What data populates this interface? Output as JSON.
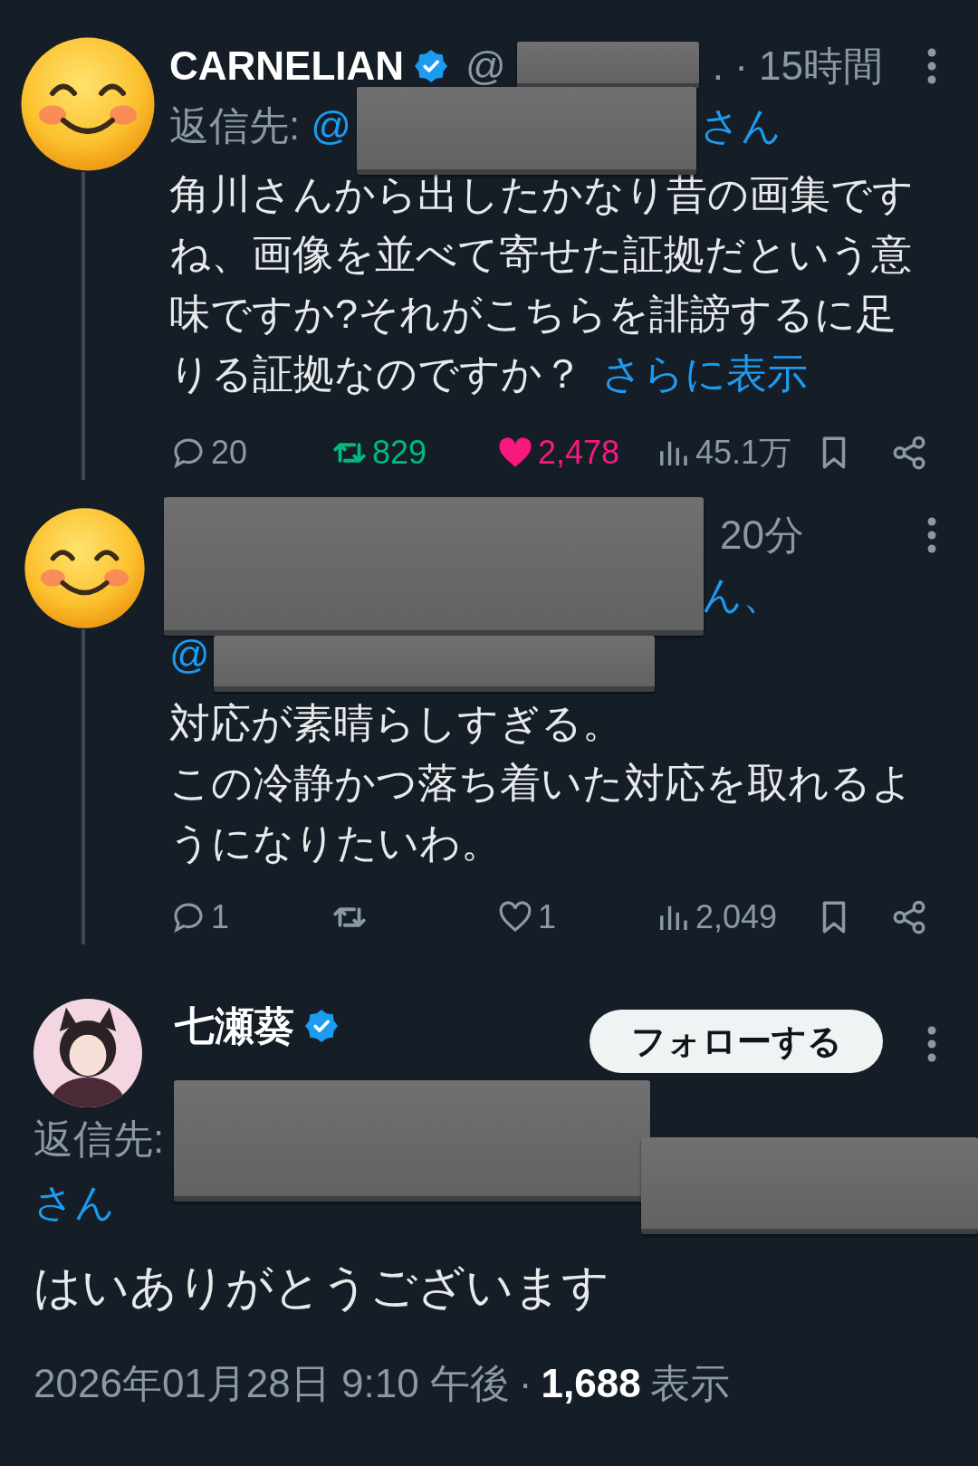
{
  "tweets": [
    {
      "kind": "thread",
      "redacted": true,
      "avatar": {
        "kind": "smiley"
      },
      "name": "CARNELIAN",
      "verified": true,
      "meta": [
        {
          "text": "@"
        },
        {
          "text": ". · 15時間"
        }
      ],
      "reply_lines": [
        [
          {
            "text": "返信先:",
            "kind": "label"
          },
          {
            "text": "@",
            "kind": "link"
          },
          {
            "text": "さん",
            "kind": "link"
          }
        ]
      ],
      "body": [
        "角川さんから出したかなり昔の画集ですね、画像を並べて寄せた証拠だという意味ですか?それがこちらを誹謗するに足りる証拠なのですか？"
      ],
      "show_more": "さらに表示",
      "stats": {
        "replies": "20",
        "retweets": "829",
        "retweeted": true,
        "likes": "2,478",
        "liked": true,
        "views": "45.1万"
      }
    },
    {
      "kind": "thread",
      "redacted": true,
      "avatar": {
        "kind": "smiley"
      },
      "meta": [
        {
          "text": "20分"
        }
      ],
      "reply_lines": [
        [
          {
            "text": "ん、",
            "kind": "link"
          }
        ],
        [
          {
            "text": "@",
            "kind": "link"
          }
        ]
      ],
      "body": [
        "対応が素晴らしすぎる。",
        "この冷静かつ落ち着いた対応を取れるようになりたいわ。"
      ],
      "stats": {
        "replies": "1",
        "retweeted": false,
        "likes": "1",
        "liked": false,
        "views": "2,049"
      }
    },
    {
      "kind": "main",
      "redacted": true,
      "avatar": {
        "kind": "figure"
      },
      "name": "七瀬葵",
      "verified": true,
      "follow": "フォローする",
      "reply_lines": [
        [
          {
            "text": "返信先:",
            "kind": "label"
          }
        ],
        [
          {
            "text": "さん",
            "kind": "link"
          }
        ]
      ],
      "body": [
        "はいありがとうございます"
      ],
      "footer": {
        "date": "2026年01月28日 9:10 午後",
        "separator": "·",
        "views": "1,688",
        "views_label": "表示"
      }
    }
  ]
}
